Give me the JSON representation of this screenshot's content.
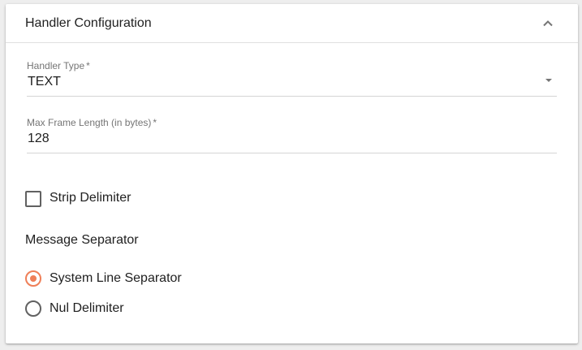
{
  "panel": {
    "title": "Handler Configuration",
    "collapse_icon": "chevron-up-icon"
  },
  "handler_type": {
    "label": "Handler Type",
    "required_mark": "*",
    "value": "TEXT",
    "dropdown_icon": "caret-down-icon"
  },
  "max_frame_length": {
    "label": "Max Frame Length (in bytes)",
    "required_mark": "*",
    "value": "128"
  },
  "strip_delimiter": {
    "label": "Strip Delimiter",
    "checked": false
  },
  "message_separator": {
    "title": "Message Separator",
    "options": [
      {
        "label": "System Line Separator",
        "selected": true
      },
      {
        "label": "Nul Delimiter",
        "selected": false
      }
    ]
  },
  "colors": {
    "accent": "#ef7f58",
    "control_border": "#616161",
    "label_text": "#757575"
  }
}
